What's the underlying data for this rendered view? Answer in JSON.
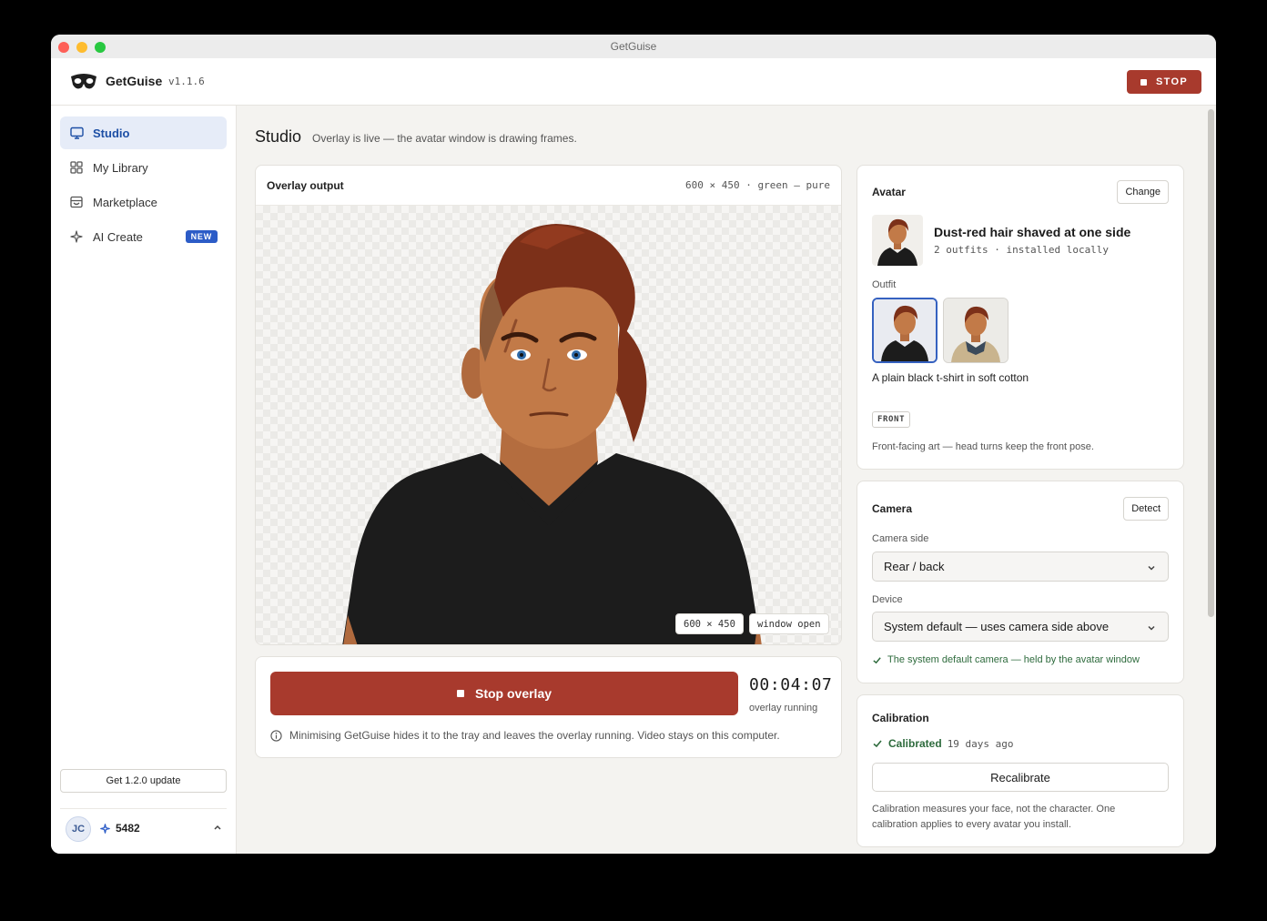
{
  "window": {
    "title": "GetGuise"
  },
  "header": {
    "app_name": "GetGuise",
    "version": "v1.1.6",
    "stop_label": "STOP"
  },
  "sidebar": {
    "items": [
      {
        "label": "Studio",
        "icon": "monitor-icon",
        "active": true
      },
      {
        "label": "My Library",
        "icon": "grid-icon"
      },
      {
        "label": "Marketplace",
        "icon": "store-icon"
      },
      {
        "label": "AI Create",
        "icon": "sparkle-icon",
        "badge": "NEW"
      }
    ],
    "update_label": "Get 1.2.0 update",
    "user": {
      "initials": "JC",
      "credits": "5482"
    }
  },
  "page": {
    "title": "Studio",
    "subtitle": "Overlay is live — the avatar window is drawing frames."
  },
  "output": {
    "title": "Overlay output",
    "meta": "600 × 450 · green — pure",
    "size_tag": "600 × 450",
    "window_tag": "window open"
  },
  "control": {
    "stop_label": "Stop overlay",
    "timer": "00:04:07",
    "timer_label": "overlay running",
    "note": "Minimising GetGuise hides it to the tray and leaves the overlay running. Video stays on this computer."
  },
  "avatar": {
    "heading": "Avatar",
    "change_label": "Change",
    "name": "Dust-red hair shaved at one side",
    "meta": "2 outfits · installed locally",
    "outfit_label": "Outfit",
    "outfit_desc": "A plain black t-shirt in soft cotton",
    "pose_tag": "FRONT",
    "pose_desc": "Front-facing art — head turns keep the front pose."
  },
  "camera": {
    "heading": "Camera",
    "detect_label": "Detect",
    "side_label": "Camera side",
    "side_value": "Rear / back",
    "device_label": "Device",
    "device_value": "System default — uses camera side above",
    "status": "The system default camera — held by the avatar window"
  },
  "calibration": {
    "heading": "Calibration",
    "status": "Calibrated",
    "ago": "19 days ago",
    "button": "Recalibrate",
    "note": "Calibration measures your face, not the character. One calibration applies to every avatar you install."
  },
  "colors": {
    "accent": "#a83a2d",
    "brand_blue": "#2c5cc7",
    "ok_green": "#2e6b3d"
  }
}
